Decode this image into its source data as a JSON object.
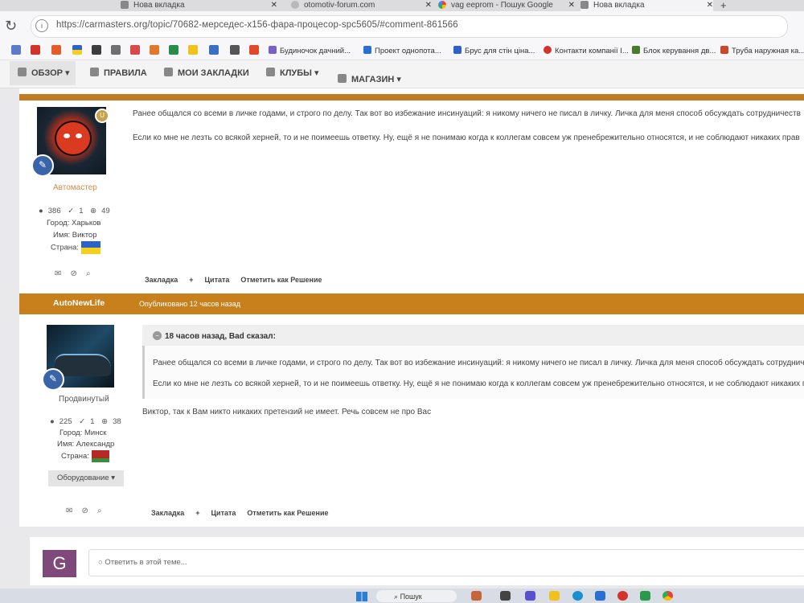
{
  "browser": {
    "tabs": [
      {
        "label": "Нова вкладка"
      },
      {
        "label": "otomotiv-forum.com"
      },
      {
        "label": "vag eeprom - Пошук Google"
      },
      {
        "label": "Нова вкладка"
      }
    ],
    "new_tab_label": "+",
    "url": "https://carmasters.org/topic/70682-мерседес-x156-фара-процесор-spc5605/#comment-861566",
    "bookmarks": [
      {
        "label": "Будиночок дачний..."
      },
      {
        "label": "Проект однопота..."
      },
      {
        "label": "Брус для стін ціна..."
      },
      {
        "label": "Контакти компанії I..."
      },
      {
        "label": "Блок керування дв..."
      },
      {
        "label": "Труба наружная ка..."
      }
    ]
  },
  "site_nav": {
    "items": [
      {
        "label": "ОБЗОР",
        "dropdown": true
      },
      {
        "label": "ПРАВИЛА"
      },
      {
        "label": "МОИ ЗАКЛАДКИ"
      },
      {
        "label": "КЛУБЫ",
        "dropdown": true
      },
      {
        "label": "МАГАЗИН",
        "dropdown": true
      }
    ]
  },
  "post1": {
    "rank": "Автомастер",
    "stats": {
      "posts": "386",
      "solutions": "1",
      "reputation": "49"
    },
    "city": "Город: Харьков",
    "name": "Имя: Виктор",
    "country_label": "Страна:",
    "text1": "Ранее общался со всеми в личке годами, и строго по делу. Так вот во избежание инсинуаций: я никому ничего не писал в личку. Личка для меня способ обсуждать сотрудничеств",
    "text2": "Если ко мне не лезть со всякой херней, то и не поимеешь ответку. Ну, ещё я не понимаю когда к коллегам совсем уж пренебрежительно относятся, и не соблюдают никаких прав",
    "actions": {
      "bookmark": "Закладка",
      "plus": "+",
      "quote": "Цитата",
      "solution": "Отметить как Решение"
    }
  },
  "post2": {
    "author": "AutoNewLife",
    "published": "Опубликовано 12 часов назад",
    "rank": "Продвинутый",
    "stats": {
      "posts": "225",
      "solutions": "1",
      "reputation": "38"
    },
    "city": "Город: Минск",
    "name": "Имя: Александр",
    "country_label": "Страна:",
    "equipment": "Оборудование ▾",
    "quote_header": "18 часов назад, Bad сказал:",
    "quote_text1": "Ранее общался со всеми в личке годами, и строго по делу. Так вот во избежание инсинуаций: я никому ничего не писал в личку. Личка для меня способ обсуждать сотрудничество",
    "quote_text2": "Если ко мне не лезть со всякой херней, то и не поимеешь ответку. Ну, ещё я не понимаю когда к коллегам совсем уж пренебрежительно относятся, и не соблюдают никаких правил",
    "reply_text": "Виктор, так к Вам никто никаких претензий не имеет. Речь совсем не про Вас",
    "actions": {
      "bookmark": "Закладка",
      "plus": "+",
      "quote": "Цитата",
      "solution": "Отметить как Решение"
    }
  },
  "reply_box": {
    "avatar_letter": "G",
    "placeholder": "Ответить в этой теме..."
  },
  "taskbar": {
    "search_label": "Пошук"
  }
}
